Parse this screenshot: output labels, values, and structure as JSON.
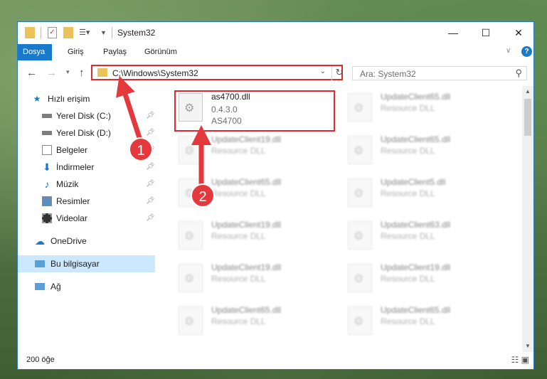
{
  "window": {
    "title": "System32",
    "controls": [
      "—",
      "☐",
      "✕"
    ]
  },
  "ribbon": {
    "tabs": [
      "Dosya",
      "Giriş",
      "Paylaş",
      "Görünüm"
    ]
  },
  "address": {
    "path": "C:\\Windows\\System32",
    "search_placeholder": "Ara: System32"
  },
  "nav": {
    "quick_access": "Hızlı erişim",
    "items": [
      {
        "label": "Yerel Disk (C:)",
        "icon": "drive-icon",
        "pinned": true
      },
      {
        "label": "Yerel Disk (D:)",
        "icon": "drive-icon",
        "pinned": true
      },
      {
        "label": "Belgeler",
        "icon": "documents-icon",
        "pinned": true
      },
      {
        "label": "İndirmeler",
        "icon": "downloads-icon",
        "pinned": true
      },
      {
        "label": "Müzik",
        "icon": "music-icon",
        "pinned": true
      },
      {
        "label": "Resimler",
        "icon": "pictures-icon",
        "pinned": true
      },
      {
        "label": "Videolar",
        "icon": "videos-icon",
        "pinned": true
      }
    ],
    "onedrive": "OneDrive",
    "this_pc": "Bu bilgisayar",
    "network": "Ağ"
  },
  "files": {
    "highlighted": {
      "name": "as4700.dll",
      "version": "0.4.3.0",
      "description": "AS4700"
    },
    "blurred": [
      {
        "name": "UpdateClient65.dll",
        "desc": "Resource DLL"
      },
      {
        "name": "UpdateClient19.dll",
        "desc": "Resource DLL"
      },
      {
        "name": "UpdateClient65.dll",
        "desc": "Resource DLL"
      },
      {
        "name": "UpdateClient65.dll",
        "desc": "Resource DLL"
      },
      {
        "name": "UpdateClient5.dll",
        "desc": "Resource DLL"
      },
      {
        "name": "UpdateClient19.dll",
        "desc": "Resource DLL"
      },
      {
        "name": "UpdateClient63.dll",
        "desc": "Resource DLL"
      },
      {
        "name": "UpdateClient19.dll",
        "desc": "Resource DLL"
      },
      {
        "name": "UpdateClient19.dll",
        "desc": "Resource DLL"
      },
      {
        "name": "UpdateClient65.dll",
        "desc": "Resource DLL"
      },
      {
        "name": "UpdateClient65.dll",
        "desc": "Resource DLL"
      }
    ]
  },
  "status": {
    "count": "200 öğe"
  },
  "annotations": {
    "step1": "1",
    "step2": "2"
  },
  "colors": {
    "accent": "#1979ca",
    "highlight": "#e0282e",
    "selection": "#cce8ff"
  }
}
